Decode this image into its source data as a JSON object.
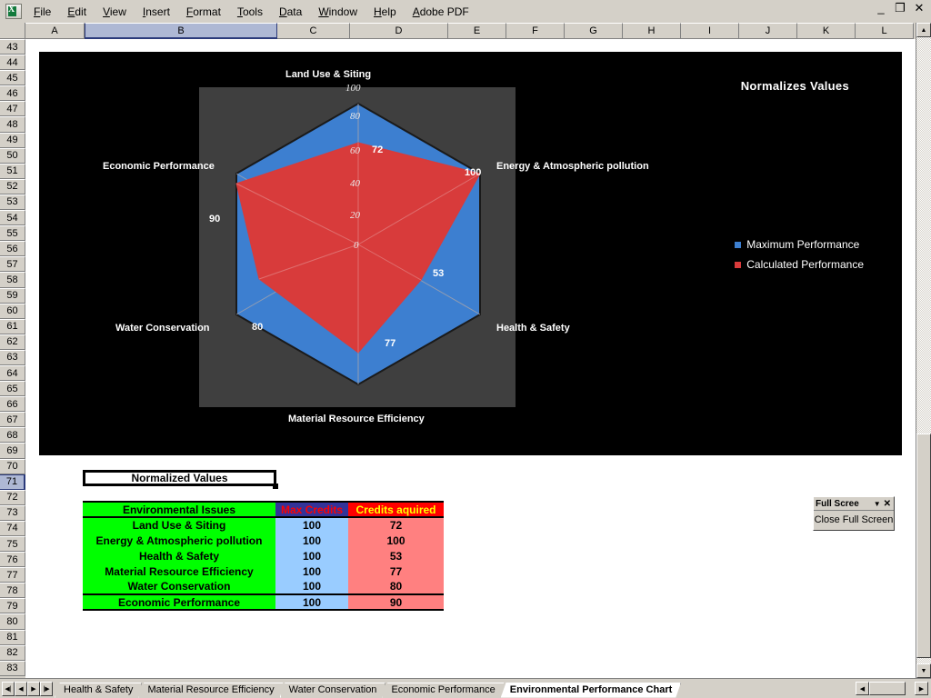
{
  "app": {
    "logo_icon": "excel-logo-icon"
  },
  "menu": {
    "items": [
      {
        "label": "File"
      },
      {
        "label": "Edit"
      },
      {
        "label": "View"
      },
      {
        "label": "Insert"
      },
      {
        "label": "Format"
      },
      {
        "label": "Tools"
      },
      {
        "label": "Data"
      },
      {
        "label": "Window"
      },
      {
        "label": "Help"
      },
      {
        "label": "Adobe PDF"
      }
    ]
  },
  "window_controls": {
    "minimize": "_",
    "restore": "❐",
    "close": "✕"
  },
  "grid": {
    "columns": [
      "A",
      "B",
      "C",
      "D",
      "E",
      "F",
      "G",
      "H",
      "I",
      "J",
      "K",
      "L"
    ],
    "selected_column": "B",
    "rows": [
      43,
      44,
      45,
      46,
      47,
      48,
      49,
      50,
      51,
      52,
      53,
      54,
      55,
      56,
      57,
      58,
      59,
      60,
      61,
      62,
      63,
      64,
      65,
      66,
      67,
      68,
      69,
      70,
      71,
      72,
      73,
      74,
      75,
      76,
      77,
      78,
      79,
      80,
      81,
      82,
      83
    ],
    "selected_row": 71
  },
  "selected_cell": {
    "value": "Normalized Values"
  },
  "chart_data": {
    "type": "radar",
    "title": "Normalizes Values",
    "categories": [
      "Land Use & Siting",
      "Energy & Atmospheric pollution",
      "Health & Safety",
      "Material Resource Efficiency",
      "Water Conservation",
      "Economic Performance"
    ],
    "series": [
      {
        "name": "Maximum Performance",
        "color": "#3d7fd0",
        "values": [
          100,
          100,
          100,
          100,
          100,
          100
        ]
      },
      {
        "name": "Calculated Performance",
        "color": "#d83b3b",
        "values": [
          72,
          100,
          53,
          77,
          80,
          90
        ]
      }
    ],
    "data_labels": [
      "72",
      "100",
      "53",
      "77",
      "80",
      "90"
    ],
    "radial_ticks": [
      "0",
      "20",
      "40",
      "60",
      "80",
      "100"
    ],
    "rlim": [
      0,
      100
    ],
    "grid": true,
    "legend_position": "right",
    "plot_background": "#3f3f3f",
    "chart_background": "#000000"
  },
  "table": {
    "headers": [
      "Environmental Issues",
      "Max Credits",
      "Credits aquired"
    ],
    "rows": [
      {
        "issue": "Land Use & Siting",
        "max": "100",
        "acquired": "72"
      },
      {
        "issue": "Energy & Atmospheric pollution",
        "max": "100",
        "acquired": "100"
      },
      {
        "issue": "Health & Safety",
        "max": "100",
        "acquired": "53"
      },
      {
        "issue": "Material Resource Efficiency",
        "max": "100",
        "acquired": "77"
      },
      {
        "issue": "Water Conservation",
        "max": "100",
        "acquired": "80"
      },
      {
        "issue": "Economic Performance",
        "max": "100",
        "acquired": "90"
      }
    ],
    "colors": {
      "issue_header_bg": "#00ff00",
      "max_header_bg": "#333399",
      "acquired_header_bg": "#ff0000",
      "issue_bg": "#00ff00",
      "max_bg": "#99ccff",
      "acquired_bg": "#ff8080"
    }
  },
  "fullscreen_toolbar": {
    "title": "Full Scree",
    "dropdown_icon": "chevron-down-icon",
    "close_icon": "close-icon",
    "button_label": "Close Full Screen"
  },
  "sheet_tabs": {
    "tabs": [
      {
        "label": "Health & Safety",
        "active": false
      },
      {
        "label": "Material Resource Efficiency",
        "active": false
      },
      {
        "label": "Water Conservation",
        "active": false
      },
      {
        "label": "Economic Performance",
        "active": false
      },
      {
        "label": "Environmental Performance Chart",
        "active": true
      }
    ],
    "nav_icons": [
      "first-sheet-icon",
      "prev-sheet-icon",
      "next-sheet-icon",
      "last-sheet-icon"
    ]
  }
}
